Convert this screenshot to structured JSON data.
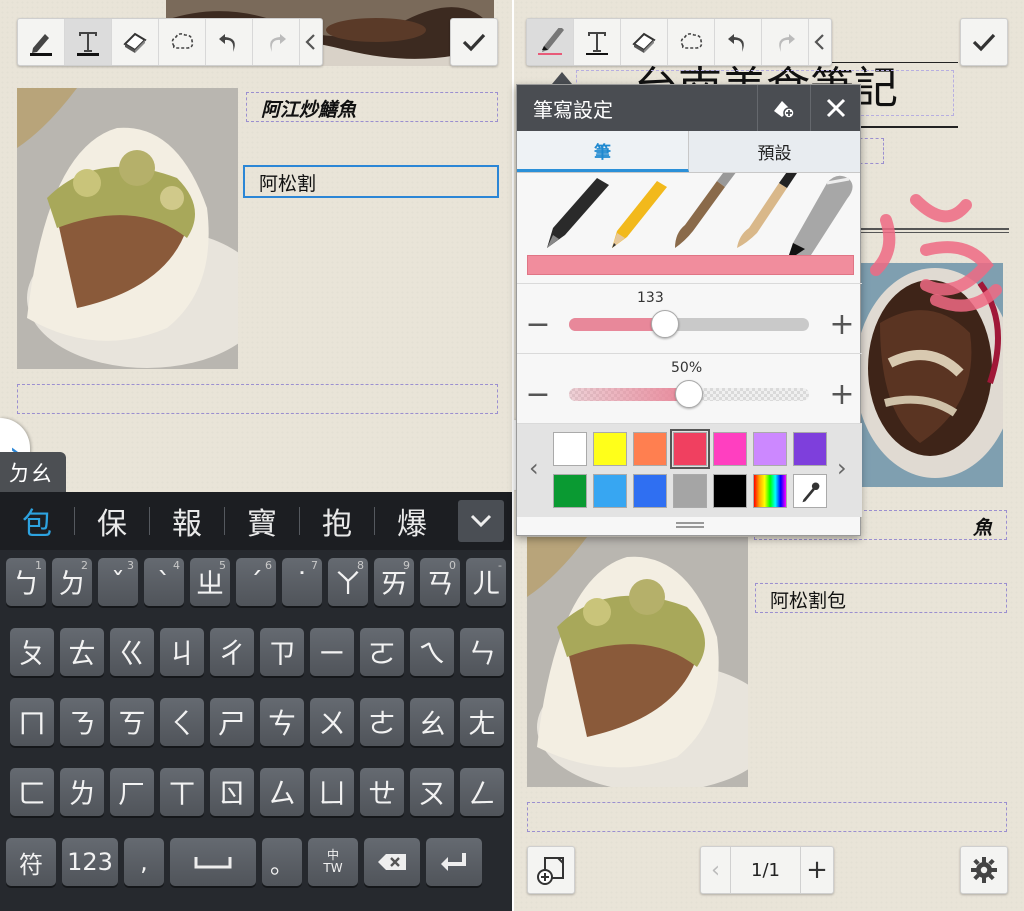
{
  "left_note": {
    "title_box": "阿江炒鱔魚",
    "focused_box": "阿松割",
    "empty_box": ""
  },
  "right_note": {
    "title_box": "阿江炒鱔魚",
    "visible_title_fragment": "魚",
    "caption_box": "阿松割包",
    "handwritten_title": "台南美食筆記"
  },
  "keyboard": {
    "composing": "ㄉㄠ",
    "candidates": [
      "包",
      "保",
      "報",
      "寶",
      "抱",
      "爆"
    ],
    "rows": [
      [
        {
          "k": "ㄅ",
          "n": "1"
        },
        {
          "k": "ㄉ",
          "n": "2"
        },
        {
          "k": "ˇ",
          "n": "3"
        },
        {
          "k": "ˋ",
          "n": "4"
        },
        {
          "k": "ㄓ",
          "n": "5"
        },
        {
          "k": "ˊ",
          "n": "6"
        },
        {
          "k": "˙",
          "n": "7"
        },
        {
          "k": "ㄚ",
          "n": "8"
        },
        {
          "k": "ㄞ",
          "n": "9"
        },
        {
          "k": "ㄢ",
          "n": "0"
        },
        {
          "k": "ㄦ",
          "n": "-"
        }
      ],
      [
        {
          "k": "ㄆ",
          "n": ""
        },
        {
          "k": "ㄊ",
          "n": ""
        },
        {
          "k": "ㄍ",
          "n": ""
        },
        {
          "k": "ㄐ",
          "n": ""
        },
        {
          "k": "ㄔ",
          "n": ""
        },
        {
          "k": "ㄗ",
          "n": ""
        },
        {
          "k": "ㄧ",
          "n": ""
        },
        {
          "k": "ㄛ",
          "n": ""
        },
        {
          "k": "ㄟ",
          "n": ""
        },
        {
          "k": "ㄣ",
          "n": ""
        }
      ],
      [
        {
          "k": "ㄇ",
          "n": ""
        },
        {
          "k": "ㄋ",
          "n": ""
        },
        {
          "k": "ㄎ",
          "n": ""
        },
        {
          "k": "ㄑ",
          "n": ""
        },
        {
          "k": "ㄕ",
          "n": ""
        },
        {
          "k": "ㄘ",
          "n": ""
        },
        {
          "k": "ㄨ",
          "n": ""
        },
        {
          "k": "ㄜ",
          "n": ""
        },
        {
          "k": "ㄠ",
          "n": ""
        },
        {
          "k": "ㄤ",
          "n": ""
        }
      ],
      [
        {
          "k": "ㄈ",
          "n": ""
        },
        {
          "k": "ㄌ",
          "n": ""
        },
        {
          "k": "ㄏ",
          "n": ""
        },
        {
          "k": "ㄒ",
          "n": ""
        },
        {
          "k": "ㄖ",
          "n": ""
        },
        {
          "k": "ㄙ",
          "n": ""
        },
        {
          "k": "ㄩ",
          "n": ""
        },
        {
          "k": "ㄝ",
          "n": ""
        },
        {
          "k": "ㄡ",
          "n": ""
        },
        {
          "k": "ㄥ",
          "n": ""
        }
      ]
    ],
    "bottom": {
      "symbol_key": "符",
      "number_key": "123",
      "comma_key": ",",
      "period_key": "。",
      "lang_key_top": "中",
      "lang_key_bottom": "TW"
    }
  },
  "pen_settings": {
    "title": "筆寫設定",
    "tabs": [
      "筆",
      "預設"
    ],
    "active_tab": 0,
    "size_value": "133",
    "size_fraction": 0.4,
    "opacity_value": "50%",
    "opacity_fraction": 0.5,
    "current_color": "#f18d9d",
    "palette": [
      "#ffffff",
      "#ffff1a",
      "#ff7f50",
      "#f04060",
      "#ff3fc0",
      "#cc88ff",
      "#7e3fdc",
      "#0a9a32",
      "#37a6f2",
      "#2f6ff2",
      "#a5a5a5",
      "#000000",
      "spectrum",
      "eyedropper"
    ],
    "selected_color_index": 3
  },
  "pager": {
    "page": "1/1"
  },
  "icons": [
    "pen-icon",
    "text-icon",
    "eraser-icon",
    "lasso-icon",
    "undo-icon",
    "redo-icon",
    "collapse-icon",
    "check-icon",
    "fill-icon",
    "close-icon",
    "add-page-icon",
    "settings-icon"
  ]
}
